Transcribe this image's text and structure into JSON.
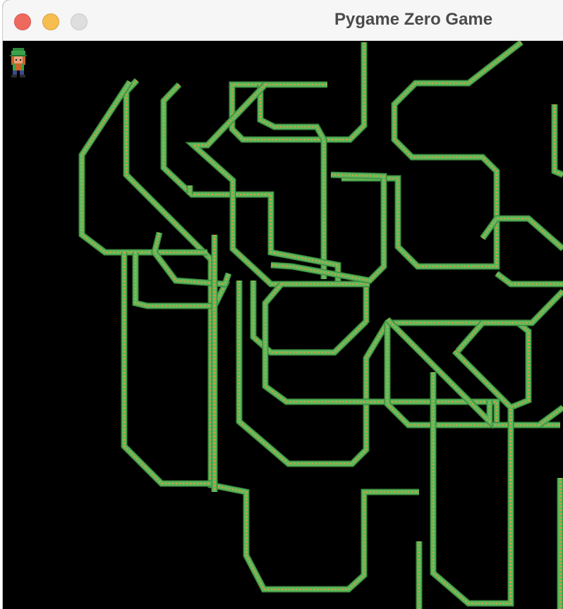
{
  "window": {
    "title": "Pygame Zero Game"
  },
  "game": {
    "background_color": "#000000",
    "trail_colors": {
      "body": "#5cb85c",
      "edge": "#3f8d3f",
      "spark": "#e59a3a"
    },
    "player": {
      "icon": "elf-character-icon",
      "hat_color": "#3aa34a",
      "face_color": "#e8a07a",
      "hair_color": "#c8662b"
    }
  }
}
